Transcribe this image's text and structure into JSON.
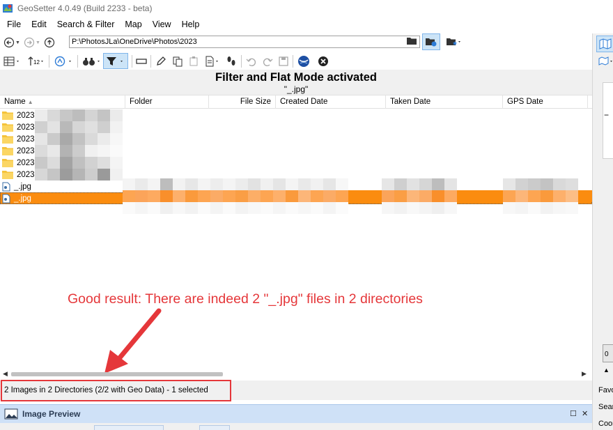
{
  "window": {
    "title": "GeoSetter 4.0.49 (Build 2233 - beta)"
  },
  "menu": [
    "File",
    "Edit",
    "Search & Filter",
    "Map",
    "View",
    "Help"
  ],
  "address": {
    "path": "P:\\PhotosJLa\\OneDrive\\Photos\\2023"
  },
  "banner": {
    "title": "Filter and Flat Mode activated",
    "filter": "\"_.jpg\""
  },
  "columns": {
    "name": "Name",
    "folder": "Folder",
    "size": "File Size",
    "created": "Created Date",
    "taken": "Taken Date",
    "gps": "GPS Date"
  },
  "rows": [
    {
      "name": "2023-(",
      "type": "folder"
    },
    {
      "name": "2023-(",
      "type": "folder"
    },
    {
      "name": "2023-(",
      "type": "folder"
    },
    {
      "name": "2023-(",
      "type": "folder"
    },
    {
      "name": "2023-(",
      "type": "folder"
    },
    {
      "name": "2023-9",
      "type": "folder"
    },
    {
      "name": "_.jpg",
      "type": "image"
    },
    {
      "name": "_.jpg",
      "type": "image",
      "selected": true
    }
  ],
  "annotation": "Good result: There are indeed 2 \"_.jpg\" files in 2 directories",
  "status": {
    "text": "2 Images in 2 Directories (2/2 with Geo Data) - 1 selected"
  },
  "preview": {
    "title": "Image Preview"
  },
  "right_panel": {
    "labels": [
      "Favo",
      "Sear",
      "Coor"
    ],
    "counter": "0"
  },
  "colors": {
    "selection": "#fb8c0f",
    "annotation": "#e5373a",
    "accent": "#cce4f7"
  }
}
